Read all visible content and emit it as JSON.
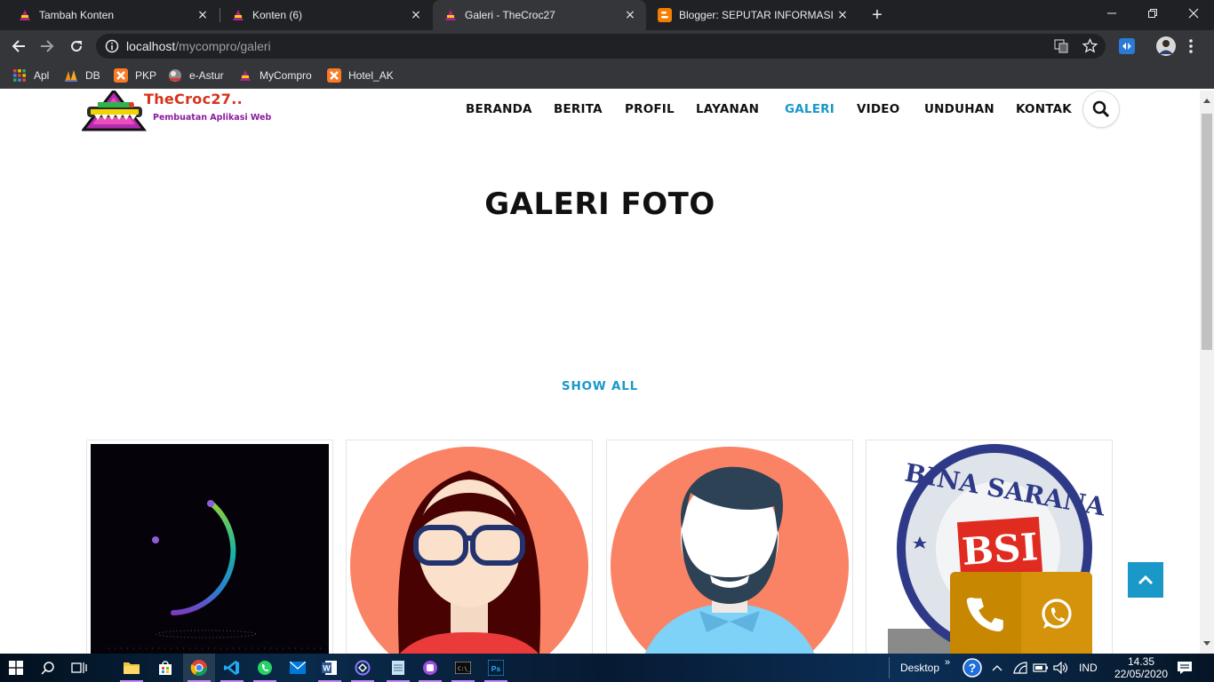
{
  "browser": {
    "tabs": [
      {
        "label": "Tambah Konten",
        "close": "×"
      },
      {
        "label": "Konten (6)",
        "close": "×"
      },
      {
        "label": "Galeri - TheCroc27",
        "close": "×"
      },
      {
        "label": "Blogger: SEPUTAR INFORMASI DAN",
        "close": "×"
      }
    ],
    "new_tab": "+",
    "url_host": "localhost",
    "url_path": "/mycompro/galeri",
    "bookmarks": [
      "Apl",
      "DB",
      "PKP",
      "e-Astur",
      "MyCompro",
      "Hotel_AK"
    ]
  },
  "site": {
    "logo_name": "TheCroc27..",
    "logo_tagline": "Pembuatan Aplikasi Web",
    "nav": [
      "BERANDA",
      "BERITA",
      "PROFIL",
      "LAYANAN",
      "GALERI",
      "VIDEO",
      "UNDUHAN",
      "KONTAK"
    ],
    "active_nav": "GALERI",
    "page_title": "GALERI FOTO",
    "filter_label": "SHOW ALL",
    "gallery": [
      {
        "image": "loading-ring-animation"
      },
      {
        "image": "female-avatar-glasses"
      },
      {
        "image": "male-avatar-beard"
      },
      {
        "image": "bina-sarana-informatika-logo",
        "logo_text": "BINA SARANA",
        "logo_mark": "BSI"
      }
    ],
    "colors": {
      "accent": "#1a98c8",
      "call_widget": "#d4930a"
    }
  },
  "taskbar": {
    "desktop_label": "Desktop",
    "language": "IND",
    "time": "14.35",
    "date": "22/05/2020"
  }
}
